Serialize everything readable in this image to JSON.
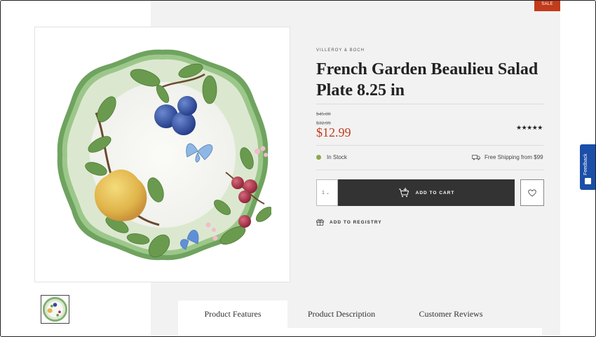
{
  "badge": {
    "sale": "SALE"
  },
  "product": {
    "brand": "VILLEROY & BOCH",
    "title": "French Garden Beaulieu Salad Plate 8.25 in",
    "price_original_1": "$45.00",
    "price_original_2": "$32.99",
    "price_current": "$12.99",
    "rating_stars": "★★★★★",
    "rating_value": 5,
    "stock_status": "In Stock",
    "shipping_text": "Free Shipping from $99"
  },
  "purchase": {
    "quantity": "1",
    "add_to_cart_label": "ADD TO CART",
    "registry_label": "ADD TO REGISTRY"
  },
  "tabs": [
    {
      "label": "Product Features",
      "active": true
    },
    {
      "label": "Product Description",
      "active": false
    },
    {
      "label": "Customer Reviews",
      "active": false
    }
  ],
  "feedback": {
    "label": "Feedback"
  },
  "colors": {
    "sale": "#c23b1c",
    "price": "#c23b1c",
    "stock_dot": "#8da84a",
    "cart_button": "#333333",
    "feedback": "#1b4fa8",
    "plate_rim": "#7fb06e"
  },
  "icons": [
    "cart-plus-icon",
    "heart-icon",
    "gift-icon",
    "truck-icon",
    "feedback-icon",
    "chevron-down-icon"
  ]
}
